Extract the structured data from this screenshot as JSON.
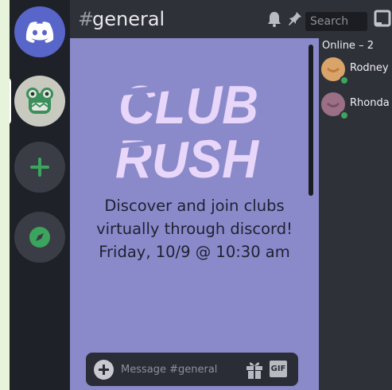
{
  "servers": {
    "home_icon": "discord-logo-icon",
    "active_server_icon": "frog-icon",
    "add_icon": "plus-icon",
    "explore_icon": "compass-icon"
  },
  "header": {
    "hash": "#",
    "channel": "general",
    "search_placeholder": "Search"
  },
  "message": {
    "logo_line1": "CLUB",
    "logo_line2": "RUSH",
    "lines": [
      "Discover and join clubs",
      "virtually through discord!",
      "Friday, 10/9 @ 10:30 am"
    ]
  },
  "composer": {
    "placeholder": "Message #general",
    "gif_label": "GIF"
  },
  "members": {
    "heading": "Online – 2",
    "list": [
      {
        "name": "Rodney",
        "status": "online",
        "avatar_color": "#d9a46a"
      },
      {
        "name": "Rhonda",
        "status": "online",
        "avatar_color": "#9b6f86"
      }
    ]
  },
  "colors": {
    "blurple": "#5865c9",
    "message_bg": "#8a8acb",
    "logo": "#e8d7fa",
    "online_green": "#3ba55d",
    "add_green": "#3ba55d"
  }
}
